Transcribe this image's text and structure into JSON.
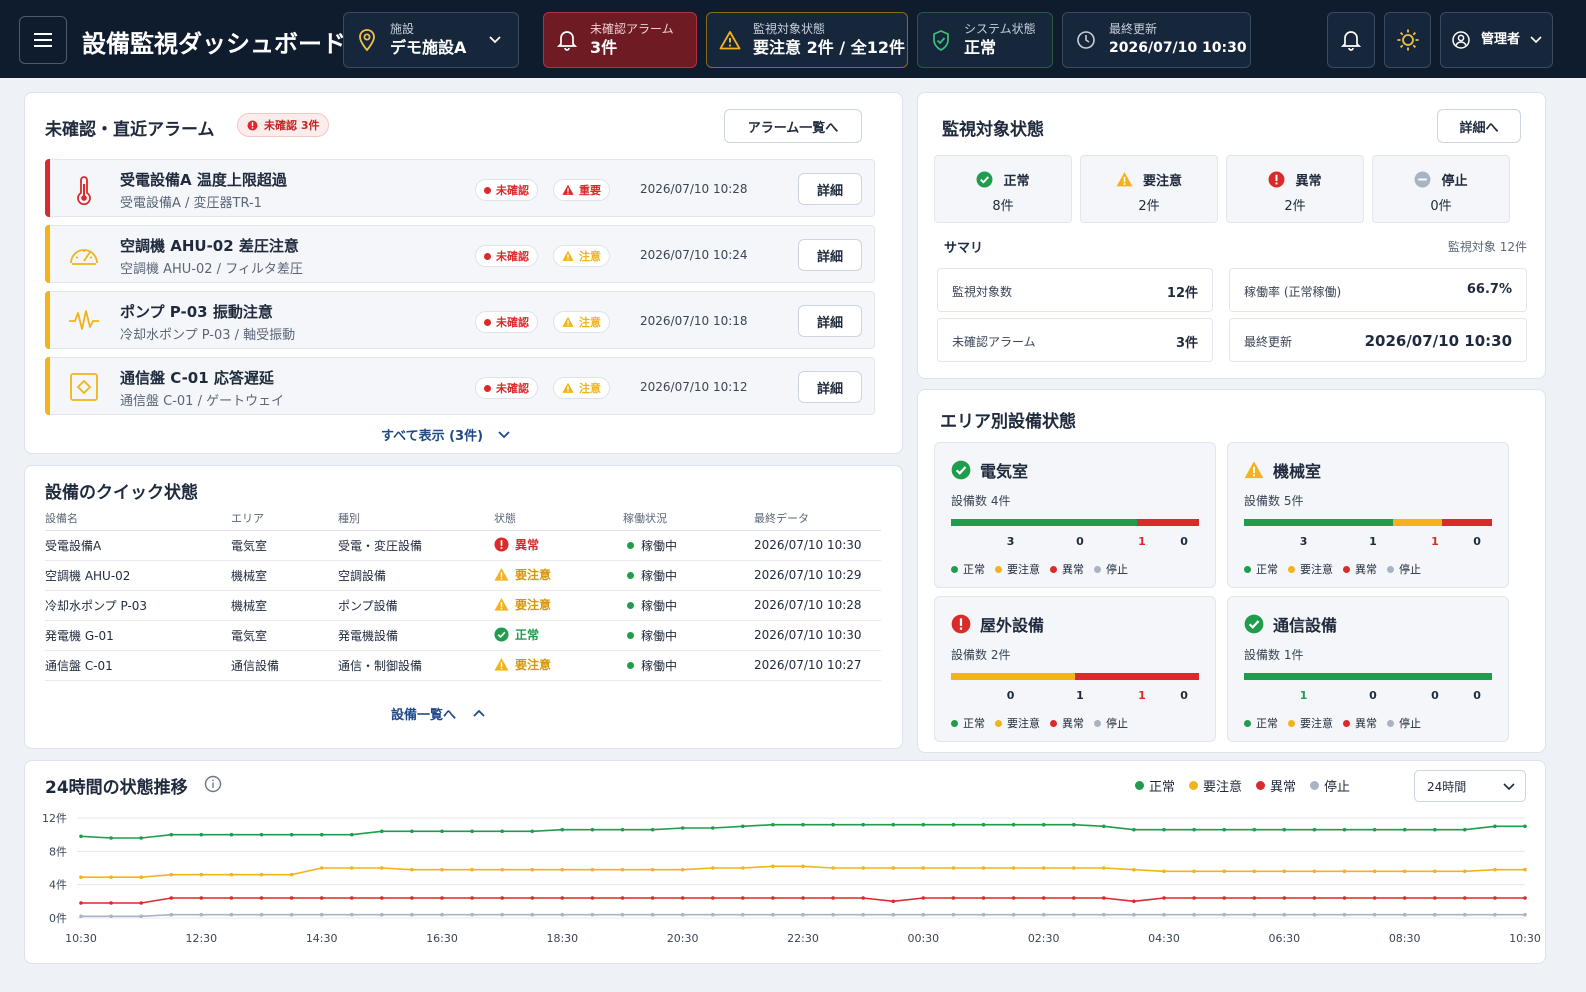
{
  "header": {
    "app_title": "設備監視ダッシュボード",
    "facility": {
      "label": "施設",
      "value": "デモ施設A"
    },
    "alarms": {
      "label": "未確認アラーム",
      "value": "3件"
    },
    "targets": {
      "label": "監視対象状態",
      "value": "要注意 2件 / 全12件"
    },
    "system": {
      "label": "システム状態",
      "value": "正常"
    },
    "updated": {
      "label": "最終更新",
      "value": "2026/07/10 10:30"
    },
    "user": "管理者"
  },
  "alarms_panel": {
    "title": "未確認・直近アラーム",
    "badge": "未確認 3件",
    "list_button": "アラーム一覧へ",
    "show_all": "すべて表示 (3件)",
    "items": [
      {
        "title": "受電設備A 温度上限超過",
        "sub": "受電設備A / 変圧器TR-1",
        "status": "未確認",
        "level": "重要",
        "time": "2026/07/10 10:28",
        "action": "詳細",
        "icon": "thermometer-icon"
      },
      {
        "title": "空調機 AHU-02 差圧注意",
        "sub": "空調機 AHU-02 / フィルタ差圧",
        "status": "未確認",
        "level": "注意",
        "time": "2026/07/10 10:24",
        "action": "詳細",
        "icon": "gauge-icon"
      },
      {
        "title": "ポンプ P-03 振動注意",
        "sub": "冷却水ポンプ P-03 / 軸受振動",
        "status": "未確認",
        "level": "注意",
        "time": "2026/07/10 10:18",
        "action": "詳細",
        "icon": "vibration-icon"
      },
      {
        "title": "通信盤 C-01 応答遅延",
        "sub": "通信盤 C-01 / ゲートウェイ",
        "status": "未確認",
        "level": "注意",
        "time": "2026/07/10 10:12",
        "action": "詳細",
        "icon": "network-panel-icon"
      }
    ]
  },
  "quick_status": {
    "title": "設備のクイック状態",
    "columns": [
      "設備名",
      "エリア",
      "種別",
      "状態",
      "稼働状況",
      "最終データ"
    ],
    "rows": [
      {
        "name": "受電設備A",
        "area": "電気室",
        "type": "受電・変圧設備",
        "state": "異常",
        "kind": "error",
        "op": "稼働中",
        "last": "2026/07/10 10:30"
      },
      {
        "name": "空調機 AHU-02",
        "area": "機械室",
        "type": "空調設備",
        "state": "要注意",
        "kind": "warn",
        "op": "稼働中",
        "last": "2026/07/10 10:29"
      },
      {
        "name": "冷却水ポンプ P-03",
        "area": "機械室",
        "type": "ポンプ設備",
        "state": "要注意",
        "kind": "warn",
        "op": "稼働中",
        "last": "2026/07/10 10:28"
      },
      {
        "name": "発電機 G-01",
        "area": "電気室",
        "type": "発電機設備",
        "state": "正常",
        "kind": "ok",
        "op": "稼働中",
        "last": "2026/07/10 10:30"
      },
      {
        "name": "通信盤 C-01",
        "area": "通信設備",
        "type": "通信・制御設備",
        "state": "要注意",
        "kind": "warn",
        "op": "稼働中",
        "last": "2026/07/10 10:27"
      }
    ],
    "more": "設備一覧へ"
  },
  "target_status": {
    "title": "監視対象状態",
    "detail_button": "詳細へ",
    "stats": [
      {
        "label": "正常",
        "value": "8件",
        "kind": "ok"
      },
      {
        "label": "要注意",
        "value": "2件",
        "kind": "warn"
      },
      {
        "label": "異常",
        "value": "2件",
        "kind": "error"
      },
      {
        "label": "停止",
        "value": "0件",
        "kind": "stop"
      }
    ],
    "summary_title": "サマリ",
    "summary_note": "監視対象 12件",
    "summary": [
      {
        "key": "監視対象数",
        "value": "12件"
      },
      {
        "key": "稼働率 (正常稼働)",
        "value": "66.7%"
      },
      {
        "key": "未確認アラーム",
        "value": "3件"
      },
      {
        "key": "最終更新",
        "value": "2026/07/10 10:30"
      }
    ]
  },
  "areas": {
    "title": "エリア別設備状態",
    "legend": [
      "正常",
      "要注意",
      "異常",
      "停止"
    ],
    "items": [
      {
        "name": "電気室",
        "count": "設備数 4件",
        "kind": "ok",
        "values": [
          3,
          0,
          1,
          0
        ]
      },
      {
        "name": "機械室",
        "count": "設備数 5件",
        "kind": "warn",
        "values": [
          3,
          1,
          1,
          0
        ]
      },
      {
        "name": "屋外設備",
        "count": "設備数 2件",
        "kind": "error",
        "values": [
          0,
          1,
          1,
          0
        ]
      },
      {
        "name": "通信設備",
        "count": "設備数 1件",
        "kind": "ok",
        "values": [
          1,
          0,
          0,
          0
        ]
      }
    ]
  },
  "colors": {
    "ok": "#1f9d4c",
    "warn": "#f2b31b",
    "error": "#d92b2b",
    "stop": "#a9b3c4",
    "ink": "#1f2a3c"
  },
  "trend": {
    "title": "24時間の状態推移",
    "range_select": "24時間",
    "chart_data": {
      "type": "line",
      "x": [
        "10:30",
        "11:00",
        "11:30",
        "12:00",
        "12:30",
        "13:00",
        "13:30",
        "14:00",
        "14:30",
        "15:00",
        "15:30",
        "16:00",
        "16:30",
        "17:00",
        "17:30",
        "18:00",
        "18:30",
        "19:00",
        "19:30",
        "20:00",
        "20:30",
        "21:00",
        "21:30",
        "22:00",
        "22:30",
        "23:00",
        "23:30",
        "00:00",
        "00:30",
        "01:00",
        "01:30",
        "02:00",
        "02:30",
        "03:00",
        "03:30",
        "04:00",
        "04:30",
        "05:00",
        "05:30",
        "06:00",
        "06:30",
        "07:00",
        "07:30",
        "08:00",
        "08:30",
        "09:00",
        "09:30",
        "10:00",
        "10:30"
      ],
      "xticks": [
        "10:30",
        "12:30",
        "14:30",
        "16:30",
        "18:30",
        "20:30",
        "22:30",
        "00:30",
        "02:30",
        "04:30",
        "06:30",
        "08:30",
        "10:30"
      ],
      "yticks": [
        "0件",
        "4件",
        "8件",
        "12件"
      ],
      "ylim": [
        0,
        12
      ],
      "series": [
        {
          "name": "正常",
          "color": "#1f9d4c",
          "values": [
            9.8,
            9.6,
            9.6,
            10.0,
            10.0,
            10.0,
            10.0,
            10.0,
            10.0,
            10.0,
            10.4,
            10.4,
            10.4,
            10.4,
            10.4,
            10.4,
            10.6,
            10.6,
            10.6,
            10.6,
            10.8,
            10.8,
            11.0,
            11.2,
            11.2,
            11.2,
            11.2,
            11.2,
            11.2,
            11.2,
            11.2,
            11.2,
            11.2,
            11.2,
            11.0,
            10.6,
            10.6,
            10.6,
            10.6,
            10.6,
            10.6,
            10.6,
            10.6,
            10.6,
            10.6,
            10.6,
            10.6,
            11.0,
            11.0
          ]
        },
        {
          "name": "要注意",
          "color": "#f2b31b",
          "values": [
            4.9,
            4.9,
            4.9,
            5.2,
            5.2,
            5.2,
            5.2,
            5.2,
            6.0,
            6.0,
            6.0,
            5.8,
            5.8,
            5.8,
            5.8,
            5.8,
            5.8,
            5.8,
            5.8,
            5.8,
            5.8,
            6.0,
            6.0,
            6.2,
            6.2,
            6.0,
            6.0,
            6.0,
            6.0,
            6.0,
            6.0,
            6.0,
            6.0,
            6.0,
            6.0,
            5.8,
            5.6,
            5.6,
            5.6,
            5.6,
            5.6,
            5.6,
            5.6,
            5.6,
            5.6,
            5.6,
            5.6,
            5.8,
            5.8
          ]
        },
        {
          "name": "異常",
          "color": "#d92b2b",
          "values": [
            1.8,
            1.8,
            1.8,
            2.4,
            2.4,
            2.4,
            2.4,
            2.4,
            2.4,
            2.4,
            2.4,
            2.4,
            2.4,
            2.4,
            2.4,
            2.4,
            2.4,
            2.4,
            2.4,
            2.4,
            2.4,
            2.4,
            2.4,
            2.4,
            2.4,
            2.4,
            2.4,
            2.0,
            2.4,
            2.4,
            2.4,
            2.4,
            2.4,
            2.4,
            2.4,
            2.0,
            2.4,
            2.4,
            2.4,
            2.4,
            2.4,
            2.4,
            2.4,
            2.4,
            2.4,
            2.4,
            2.4,
            2.4,
            2.4
          ]
        },
        {
          "name": "停止",
          "color": "#a9b3c4",
          "values": [
            0.2,
            0.2,
            0.2,
            0.4,
            0.4,
            0.4,
            0.4,
            0.4,
            0.4,
            0.4,
            0.4,
            0.4,
            0.4,
            0.4,
            0.4,
            0.4,
            0.4,
            0.4,
            0.4,
            0.4,
            0.4,
            0.4,
            0.4,
            0.4,
            0.4,
            0.4,
            0.4,
            0.4,
            0.4,
            0.4,
            0.4,
            0.4,
            0.4,
            0.4,
            0.4,
            0.4,
            0.4,
            0.4,
            0.4,
            0.4,
            0.4,
            0.4,
            0.4,
            0.4,
            0.4,
            0.4,
            0.4,
            0.4,
            0.4
          ]
        }
      ]
    }
  }
}
